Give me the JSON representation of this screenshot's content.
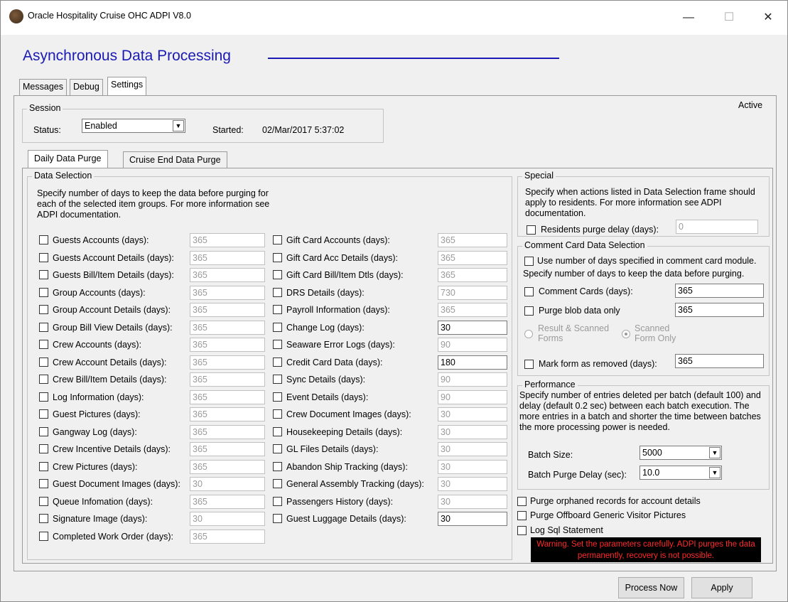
{
  "window": {
    "title": "Oracle Hospitality Cruise OHC ADPI V8.0",
    "minimize": "—",
    "maximize": "☐",
    "close": "✕"
  },
  "header": {
    "title": "Asynchronous Data Processing",
    "status_text": "Active"
  },
  "tabs": [
    "Messages",
    "Debug",
    "Settings"
  ],
  "session": {
    "legend": "Session",
    "status_label": "Status:",
    "status_value": "Enabled",
    "started_label": "Started:",
    "started_value": "02/Mar/2017 5:37:02"
  },
  "subtabs": [
    "Daily Data Purge",
    "Cruise End Data Purge"
  ],
  "data_selection": {
    "legend": "Data Selection",
    "description": "Specify number of days to keep the data before purging for each of the selected item groups. For more information see ADPI documentation.",
    "left_items": [
      {
        "label": "Guests Accounts (days):",
        "value": "365"
      },
      {
        "label": "Guests Account Details (days):",
        "value": "365"
      },
      {
        "label": "Guests Bill/Item Details (days):",
        "value": "365"
      },
      {
        "label": "Group Accounts (days):",
        "value": "365"
      },
      {
        "label": "Group Account Details (days):",
        "value": "365"
      },
      {
        "label": "Group Bill View Details (days):",
        "value": "365"
      },
      {
        "label": "Crew Accounts (days):",
        "value": "365"
      },
      {
        "label": "Crew Account Details (days):",
        "value": "365"
      },
      {
        "label": "Crew Bill/Item Details (days):",
        "value": "365"
      },
      {
        "label": "Log Information (days):",
        "value": "365"
      },
      {
        "label": "Guest Pictures (days):",
        "value": "365"
      },
      {
        "label": "Gangway Log (days):",
        "value": "365"
      },
      {
        "label": "Crew Incentive Details (days):",
        "value": "365"
      },
      {
        "label": "Crew Pictures (days):",
        "value": "365"
      },
      {
        "label": "Guest Document Images (days):",
        "value": "30"
      },
      {
        "label": "Queue Infomation (days):",
        "value": "365"
      },
      {
        "label": "Signature Image (days):",
        "value": "30"
      },
      {
        "label": "Completed Work Order (days):",
        "value": "365"
      }
    ],
    "right_items": [
      {
        "label": "Gift Card Accounts (days):",
        "value": "365",
        "enabled": false
      },
      {
        "label": "Gift Card Acc Details (days):",
        "value": "365",
        "enabled": false
      },
      {
        "label": "Gift Card Bill/Item Dtls (days):",
        "value": "365",
        "enabled": false
      },
      {
        "label": "DRS Details (days):",
        "value": "730",
        "enabled": false
      },
      {
        "label": "Payroll Information (days):",
        "value": "365",
        "enabled": false
      },
      {
        "label": "Change Log (days):",
        "value": "30",
        "enabled": true
      },
      {
        "label": "Seaware Error Logs (days):",
        "value": "90",
        "enabled": false
      },
      {
        "label": "Credit Card Data (days):",
        "value": "180",
        "enabled": true
      },
      {
        "label": "Sync Details (days):",
        "value": "90",
        "enabled": false
      },
      {
        "label": "Event Details (days):",
        "value": "90",
        "enabled": false
      },
      {
        "label": "Crew Document Images (days):",
        "value": "30",
        "enabled": false
      },
      {
        "label": "Housekeeping Details (days):",
        "value": "30",
        "enabled": false
      },
      {
        "label": "GL Files Details (days):",
        "value": "30",
        "enabled": false
      },
      {
        "label": "Abandon Ship Tracking (days):",
        "value": "30",
        "enabled": false
      },
      {
        "label": "General Assembly Tracking (days):",
        "value": "30",
        "enabled": false
      },
      {
        "label": "Passengers History (days):",
        "value": "30",
        "enabled": false
      },
      {
        "label": "Guest Luggage Details (days):",
        "value": "30",
        "enabled": true
      }
    ]
  },
  "special": {
    "legend": "Special",
    "description": "Specify when actions listed in Data Selection frame should apply to residents. For more information see ADPI documentation.",
    "residents_label": "Residents purge delay (days):",
    "residents_value": "0"
  },
  "comment_card": {
    "legend": "Comment Card Data Selection",
    "use_module_label": "Use number of days specified in comment card module.",
    "specify_text": "Specify number of days to keep the data before purging.",
    "comment_cards_label": "Comment Cards (days):",
    "comment_cards_value": "365",
    "purge_blob_label": "Purge blob data only",
    "purge_blob_value": "365",
    "radio_result_label": "Result & Scanned Forms",
    "radio_scanned_label": "Scanned Form Only",
    "mark_removed_label": "Mark form as removed (days):",
    "mark_removed_value": "365"
  },
  "performance": {
    "legend": "Performance",
    "description": "Specify number of entries deleted per batch (default 100) and delay (default 0.2 sec) between each batch execution. The more entries in a batch and shorter the time between batches the more processing power is needed.",
    "batch_size_label": "Batch Size:",
    "batch_size_value": "5000",
    "batch_delay_label": "Batch Purge Delay (sec):",
    "batch_delay_value": "10.0"
  },
  "options": {
    "purge_orphaned": "Purge orphaned records for account details",
    "purge_offboard": "Purge Offboard Generic Visitor Pictures",
    "log_sql": "Log Sql Statement"
  },
  "warning": "Warning. Set the parameters carefully. ADPI purges the data permanently, recovery is not possible.",
  "buttons": {
    "process_now": "Process Now",
    "apply": "Apply"
  },
  "colors": {
    "title_blue": "#1a1ab4",
    "warning_red": "#ff2a2a",
    "warning_bg": "#000000"
  }
}
